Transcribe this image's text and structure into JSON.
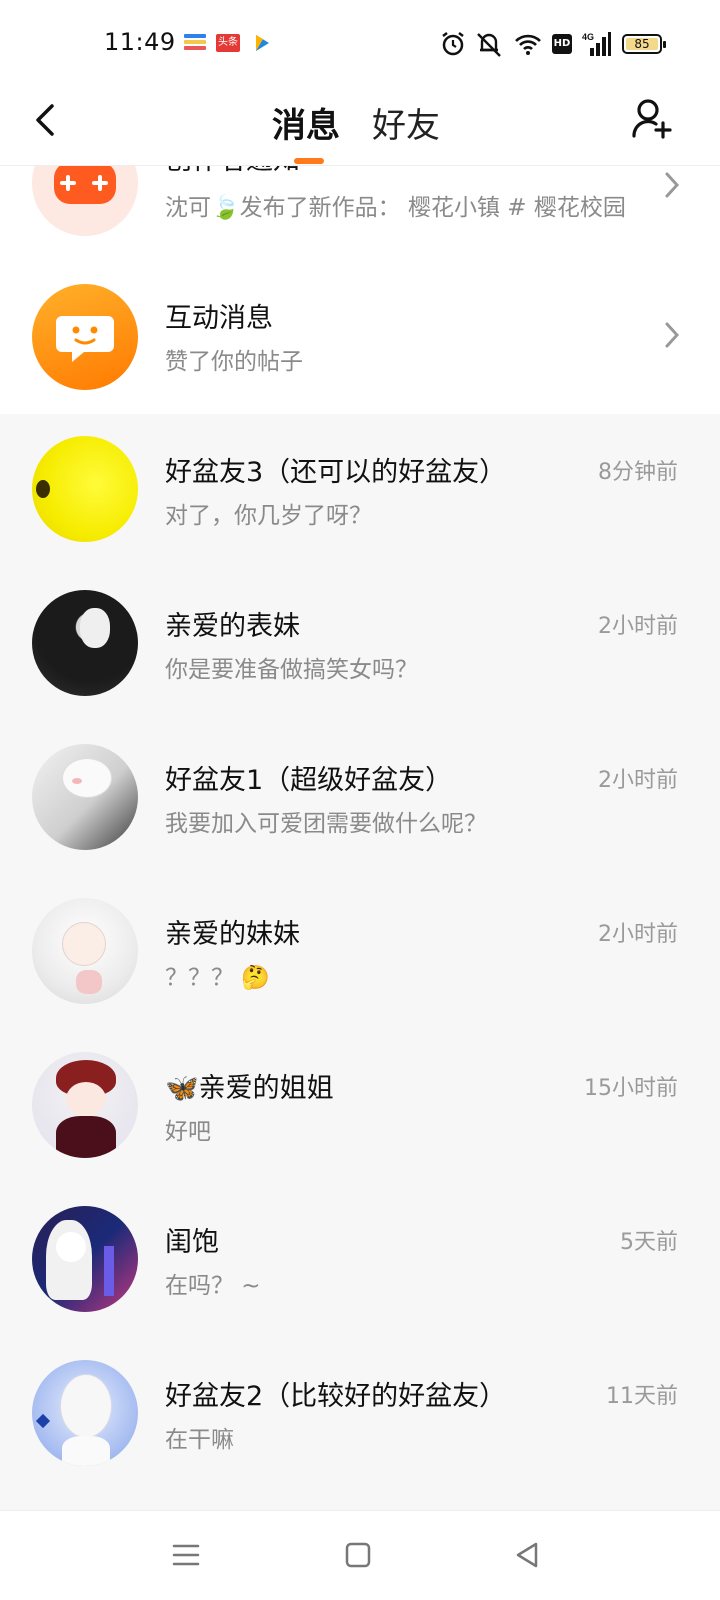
{
  "status_bar": {
    "time": "11:49",
    "app_icons": [
      "wallet-app-icon",
      "toutiao-app-icon",
      "video-app-icon"
    ],
    "toutiao_label": "头条",
    "battery": "85"
  },
  "header": {
    "tabs": [
      {
        "label": "消息",
        "active": true
      },
      {
        "label": "好友",
        "active": false
      }
    ],
    "accent": "#ff7a1a"
  },
  "notifications": [
    {
      "title": "创作者通知",
      "subtitle": "沈可🍃发布了新作品：  樱花小镇 # 樱花校园",
      "icon": "gamepad-icon"
    },
    {
      "title": "互动消息",
      "subtitle": "赞了你的帖子",
      "icon": "chat-bubble-icon"
    }
  ],
  "chats": [
    {
      "name": "好盆友3（还可以的好盆友）",
      "preview": "对了，你几岁了呀？",
      "time": "8分钟前"
    },
    {
      "name": "亲爱的表妹",
      "preview": "你是要准备做搞笑女吗？",
      "time": "2小时前"
    },
    {
      "name": "好盆友1（超级好盆友）",
      "preview": "我要加入可爱团需要做什么呢？",
      "time": "2小时前"
    },
    {
      "name": "亲爱的妹妹",
      "preview": "？？？ 🤔",
      "time": "2小时前"
    },
    {
      "name": "🦋亲爱的姐姐",
      "preview": "好吧",
      "time": "15小时前"
    },
    {
      "name": "闺饱",
      "preview": "在吗？ ~",
      "time": "5天前"
    },
    {
      "name": "好盆友2（比较好的好盆友）",
      "preview": "在干嘛",
      "time": "11天前"
    }
  ],
  "nav": [
    "menu-icon",
    "home-square-icon",
    "back-triangle-icon"
  ]
}
